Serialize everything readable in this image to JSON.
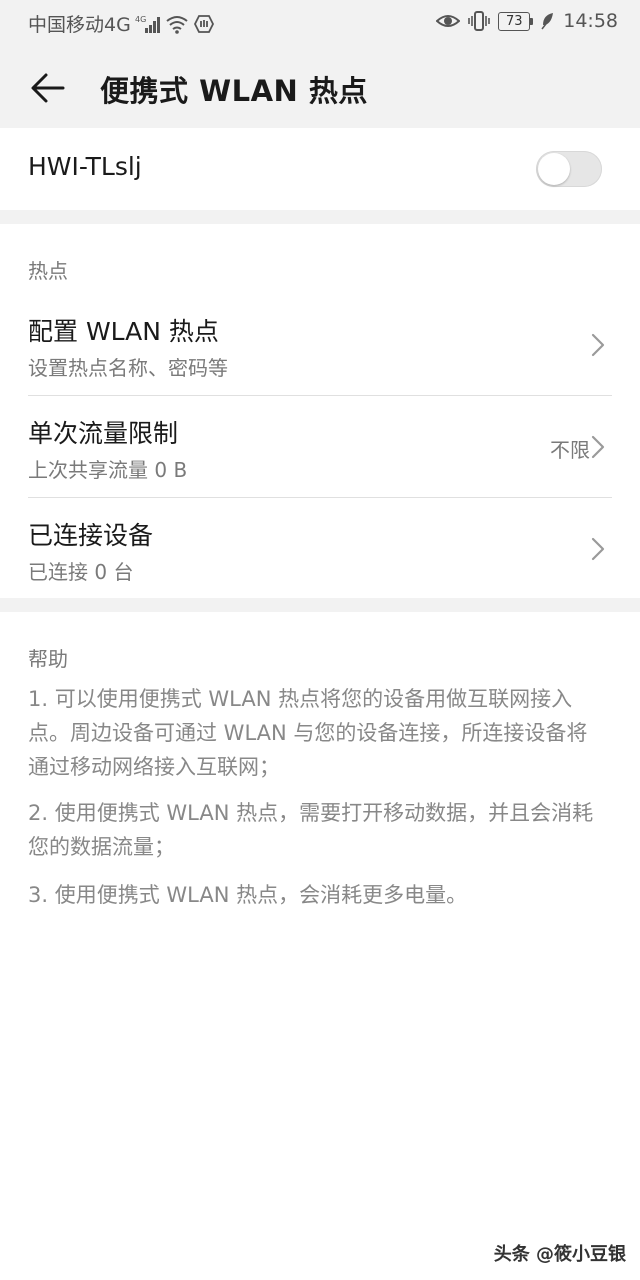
{
  "status_bar": {
    "carrier": "中国移动4G",
    "network_badge": "4G",
    "battery": "73",
    "time": "14:58",
    "icons": [
      "signal-icon",
      "wifi-icon",
      "hotspot-status-icon",
      "eye-comfort-icon",
      "vibrate-icon",
      "battery-icon",
      "leaf-icon"
    ]
  },
  "header": {
    "title": "便携式 WLAN 热点",
    "back_icon": "arrow-left-icon"
  },
  "hotspot_switch": {
    "name": "HWI-TLslj",
    "enabled": false
  },
  "hotspot_section": {
    "label": "热点",
    "items": [
      {
        "title": "配置 WLAN 热点",
        "subtitle": "设置热点名称、密码等",
        "value": ""
      },
      {
        "title": "单次流量限制",
        "subtitle": "上次共享流量 0 B",
        "value": "不限"
      },
      {
        "title": "已连接设备",
        "subtitle": "已连接 0 台",
        "value": ""
      }
    ]
  },
  "help_section": {
    "label": "帮助",
    "paragraphs": [
      "1. 可以使用便携式 WLAN 热点将您的设备用做互联网接入点。周边设备可通过 WLAN 与您的设备连接，所连接设备将通过移动网络接入互联网；",
      "2. 使用便携式 WLAN 热点，需要打开移动数据，并且会消耗您的数据流量；",
      "3. 使用便携式 WLAN 热点，会消耗更多电量。"
    ]
  },
  "watermark": "头条 @筱小豆银",
  "colors": {
    "header_bg": "#f2f2f2",
    "text_primary": "#1a1a1a",
    "text_secondary": "#7a7a7a",
    "toggle_off": "#e6e6e6"
  }
}
